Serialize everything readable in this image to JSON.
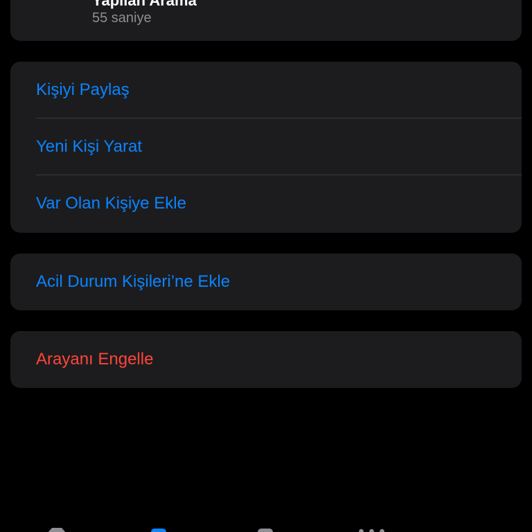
{
  "call": {
    "title": "Yapılan Arama",
    "duration": "55 saniye"
  },
  "contact_actions": [
    {
      "label": "Kişiyi Paylaş"
    },
    {
      "label": "Yeni Kişi Yarat"
    },
    {
      "label": "Var Olan Kişiye Ekle"
    }
  ],
  "emergency": {
    "label": "Acil Durum Kişileri’ne Ekle"
  },
  "block": {
    "label": "Arayanı Engelle"
  },
  "tabbar": {
    "items": [
      {
        "icon": "star-icon"
      },
      {
        "icon": "clock-icon",
        "active": true
      },
      {
        "icon": "person-icon"
      },
      {
        "icon": "keypad-icon"
      }
    ]
  },
  "colors": {
    "background": "#000000",
    "card": "#1c1c1e",
    "separator": "#3a3a3c",
    "link": "#0a84ff",
    "destructive": "#ff453a",
    "secondary_text": "#8e8e93"
  }
}
